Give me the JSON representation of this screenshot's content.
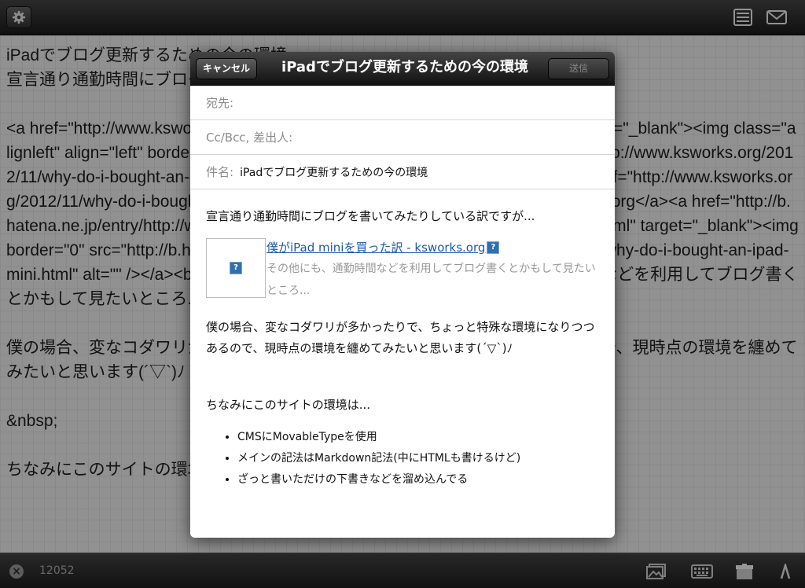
{
  "editor": {
    "text": "iPadでブログ更新するための今の環境\n宣言通り通勤時間にブログを書いてみたりしている訳ですが...\n\n<a href=\"http://www.ksworks.org/2012/11/why-do-i-bought-an-ipad-mini.html\" target=\"_blank\"><img class=\"alignleft\" align=\"left\" border=\"0\" src=\"http://capture.heartrails.com/75x75/shadow?http://www.ksworks.org/2012/11/why-do-i-bought-an-ipad-mini.html\" alt=\"\" width=\"75\" height=\"75\" /></a><a href=\"http://www.ksworks.org/2012/11/why-do-i-bought-an-ipad-mini.html\">僕がiPad miniを買った訳 - ksworks.org</a><a href=\"http://b.hatena.ne.jp/entry/http://www.ksworks.org/2012/11/why-do-i-bought-an-ipad-mini.html\" target=\"_blank\"><img border=\"0\" src=\"http://b.hatena.ne.jp/entry/image/http://www.ksworks.org/2012/11/why-do-i-bought-an-ipad-mini.html\" alt=\"\" /></a><br /><span style=\"font-size:80%;\">その他にも、通勤時間などを利用してブログ書くとかもして見たいところ...</span><br style=\"clear:both;\" /><br>\n\n僕の場合、変なコダワリが多かったりで、ちょっと特殊な環境になりつつあるので、現時点の環境を纏めてみたいと思います(´▽`)ﾉ\n\n&nbsp;\n\nちなみにこのサイトの環境は..."
  },
  "bottombar": {
    "char_count": "12052"
  },
  "mail": {
    "cancel_label": "キャンセル",
    "title": "iPadでブログ更新するための今の環境",
    "send_label": "送信",
    "to_label": "宛先:",
    "cc_label": "Cc/Bcc, 差出人:",
    "subject_label": "件名:",
    "subject_value": "iPadでブログ更新するための今の環境",
    "body": {
      "intro": "宣言通り通勤時間にブログを書いてみたりしている訳ですが...",
      "link_title": "僕がiPad miniを買った訳 - ksworks.org",
      "link_desc": "その他にも、通勤時間などを利用してブログ書くとかもして見たいところ...",
      "para2": "僕の場合、変なコダワリが多かったりで、ちょっと特殊な環境になりつつあるので、現時点の環境を纏めてみたいと思います(´▽`)ﾉ",
      "para3": "ちなみにこのサイトの環境は...",
      "bullets": [
        "CMSにMovableTypeを使用",
        "メインの記法はMarkdown記法(中にHTMLも書けるけど)",
        "ざっと書いただけの下書きなどを溜め込んでる"
      ]
    }
  },
  "icons": {
    "gear": "gear-icon",
    "list": "list-icon",
    "mail": "mail-icon",
    "photo": "photo-icon",
    "keyboard": "keyboard-icon",
    "box": "box-icon",
    "caret": "caret-icon",
    "broken_image": "broken-image-icon"
  }
}
